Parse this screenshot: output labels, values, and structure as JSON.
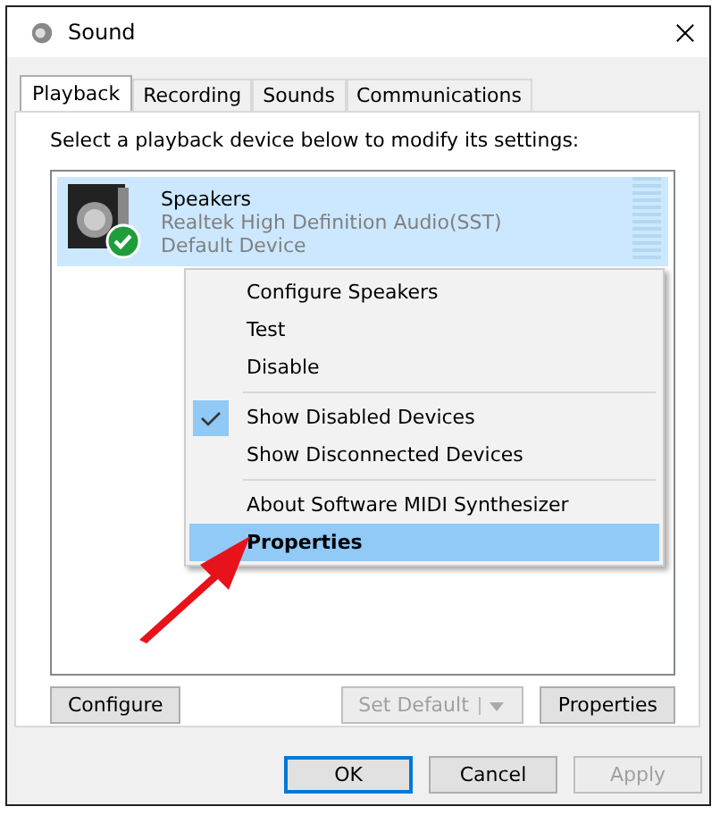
{
  "window": {
    "title": "Sound"
  },
  "tabs": [
    {
      "label": "Playback",
      "selected": true
    },
    {
      "label": "Recording",
      "selected": false
    },
    {
      "label": "Sounds",
      "selected": false
    },
    {
      "label": "Communications",
      "selected": false
    }
  ],
  "instruction": "Select a playback device below to modify its settings:",
  "devices": [
    {
      "name": "Speakers",
      "driver": "Realtek High Definition Audio(SST)",
      "status": "Default Device",
      "selected": true,
      "is_default": true,
      "level": 0
    }
  ],
  "context_menu": [
    {
      "kind": "item",
      "label": "Configure Speakers",
      "checked": false,
      "highlighted": false,
      "bold": false
    },
    {
      "kind": "item",
      "label": "Test",
      "checked": false,
      "highlighted": false,
      "bold": false
    },
    {
      "kind": "item",
      "label": "Disable",
      "checked": false,
      "highlighted": false,
      "bold": false
    },
    {
      "kind": "separator"
    },
    {
      "kind": "item",
      "label": "Show Disabled Devices",
      "checked": true,
      "highlighted": false,
      "bold": false
    },
    {
      "kind": "item",
      "label": "Show Disconnected Devices",
      "checked": false,
      "highlighted": false,
      "bold": false
    },
    {
      "kind": "separator"
    },
    {
      "kind": "item",
      "label": "About Software MIDI Synthesizer",
      "checked": false,
      "highlighted": false,
      "bold": false
    },
    {
      "kind": "item",
      "label": "Properties",
      "checked": false,
      "highlighted": true,
      "bold": true
    }
  ],
  "panel_buttons": [
    {
      "label": "Configure",
      "disabled": false,
      "split": false
    },
    {
      "label": "Set Default",
      "disabled": true,
      "split": true
    },
    {
      "label": "Properties",
      "disabled": false,
      "split": false
    }
  ],
  "dialog_buttons": [
    {
      "label": "OK",
      "disabled": false,
      "focused": true
    },
    {
      "label": "Cancel",
      "disabled": false,
      "focused": false
    },
    {
      "label": "Apply",
      "disabled": true,
      "focused": false
    }
  ]
}
